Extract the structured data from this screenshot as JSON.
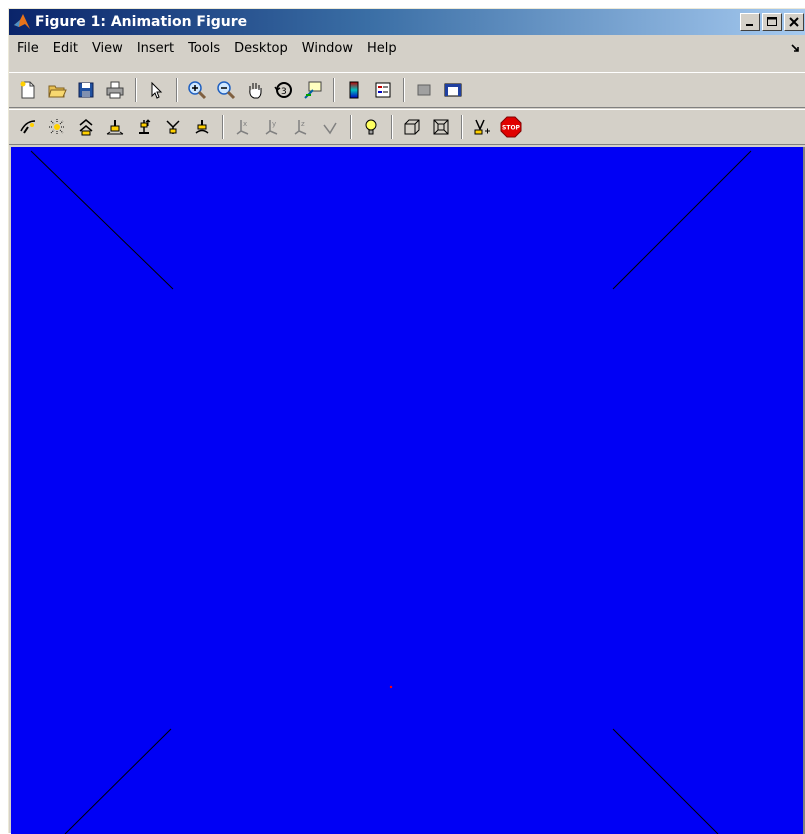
{
  "window": {
    "title": "Figure 1: Animation Figure",
    "icon": "matlab-logo-icon"
  },
  "caption_buttons": [
    {
      "name": "minimize",
      "icon": "minimize-icon"
    },
    {
      "name": "maximize",
      "icon": "maximize-icon"
    },
    {
      "name": "close",
      "icon": "close-icon"
    }
  ],
  "menu": {
    "items": [
      "File",
      "Edit",
      "View",
      "Insert",
      "Tools",
      "Desktop",
      "Window",
      "Help"
    ],
    "dock_icon": "dock-arrow-icon"
  },
  "toolbar_figure": {
    "buttons": [
      "new-figure-icon",
      "open-file-icon",
      "save-icon",
      "print-icon",
      "|",
      "edit-plot-icon",
      "|",
      "zoom-in-icon",
      "zoom-out-icon",
      "pan-icon",
      "rotate-3d-icon",
      "data-cursor-icon",
      "|",
      "insert-colorbar-icon",
      "insert-legend-icon",
      "|",
      "hide-plot-tools-icon",
      "show-plot-tools-icon"
    ]
  },
  "toolbar_camera": {
    "buttons": [
      "orbit-camera-icon",
      "orbit-light-icon",
      "pan-tilt-camera-icon",
      "move-camera-horizontal-icon",
      "move-camera-forward-icon",
      "zoom-camera-icon",
      "roll-camera-icon",
      "|",
      "principal-axis-x-icon",
      "principal-axis-y-icon",
      "principal-axis-z-icon",
      "no-principal-axis-icon",
      "|",
      "toggle-scene-light-icon",
      "|",
      "orthographic-projection-icon",
      "perspective-projection-icon",
      "|",
      "reset-camera-icon",
      "stop-camera-icon"
    ]
  },
  "figure": {
    "background_color": "#0000f5",
    "line_color": "#000000",
    "marker_color": "#ff0000"
  }
}
